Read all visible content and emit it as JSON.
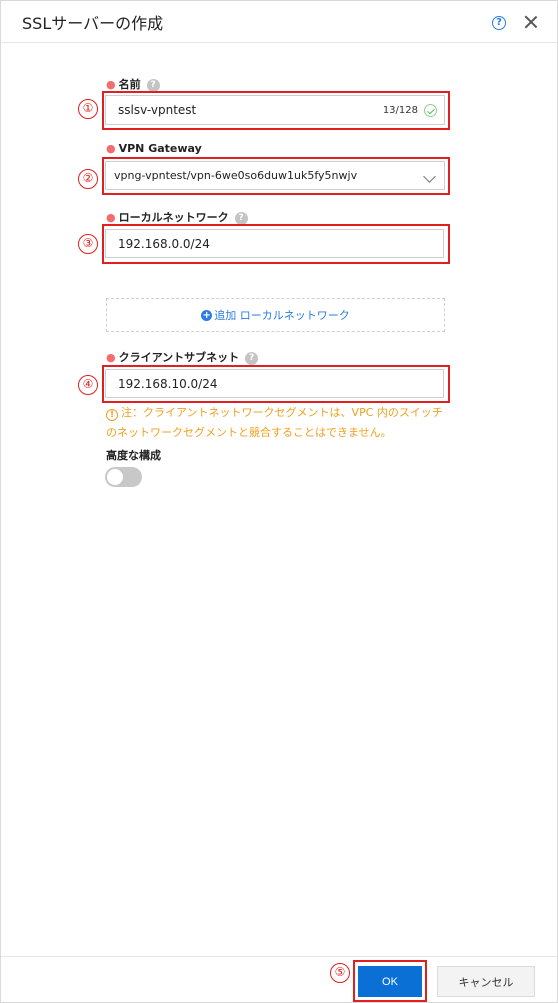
{
  "dialog": {
    "title": "SSLサーバーの作成",
    "help_icon_glyph": "?",
    "close_icon": "close-icon"
  },
  "markers": [
    "①",
    "②",
    "③",
    "④",
    "⑤"
  ],
  "required_mark": "●",
  "hint_glyph": "?",
  "form": {
    "name": {
      "label": "名前",
      "value": "sslsv-vpntest",
      "counter": "13/128"
    },
    "vpn_gateway": {
      "label": "VPN Gateway",
      "value": "vpng-vpntest/vpn-6we0so6duw1uk5fy5nwjv"
    },
    "local_network": {
      "label": "ローカルネットワーク",
      "value": "192.168.0.0/24",
      "add_label": "追加 ローカルネットワーク",
      "add_glyph": "+"
    },
    "client_subnet": {
      "label": "クライアントサブネット",
      "value": "192.168.10.0/24",
      "warning_line1": "注：クライアントネットワークセグメントは、VPC 内のスイッチ",
      "warning_line2": "のネットワークセグメントと競合することはできません。",
      "warning_glyph": "!"
    },
    "advanced": {
      "label": "高度な構成",
      "enabled": false
    }
  },
  "footer": {
    "ok_label": "OK",
    "cancel_label": "キャンセル"
  },
  "colors": {
    "primary": "#0a70d6",
    "annotation_red": "#e02020",
    "warning": "#f0a020",
    "required_dot": "#f56c6c"
  }
}
